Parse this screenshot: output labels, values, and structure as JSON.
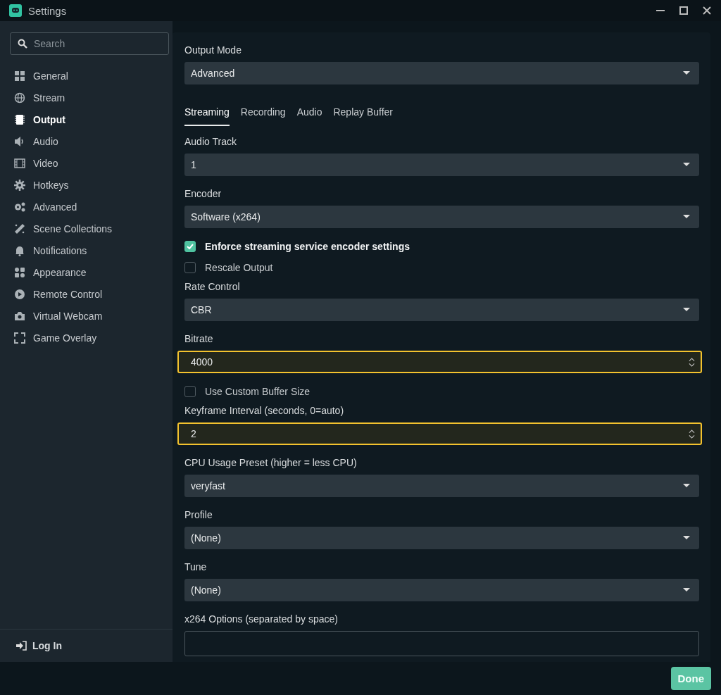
{
  "window": {
    "title": "Settings"
  },
  "sidebar": {
    "search": {
      "placeholder": "Search"
    },
    "items": [
      {
        "label": "General",
        "selected": false
      },
      {
        "label": "Stream",
        "selected": false
      },
      {
        "label": "Output",
        "selected": true
      },
      {
        "label": "Audio",
        "selected": false
      },
      {
        "label": "Video",
        "selected": false
      },
      {
        "label": "Hotkeys",
        "selected": false
      },
      {
        "label": "Advanced",
        "selected": false
      },
      {
        "label": "Scene Collections",
        "selected": false
      },
      {
        "label": "Notifications",
        "selected": false
      },
      {
        "label": "Appearance",
        "selected": false
      },
      {
        "label": "Remote Control",
        "selected": false
      },
      {
        "label": "Virtual Webcam",
        "selected": false
      },
      {
        "label": "Game Overlay",
        "selected": false
      }
    ],
    "login": "Log In"
  },
  "settings": [
    {
      "kind": "select",
      "label": "Output Mode",
      "value": "Advanced"
    },
    {
      "kind": "tabs",
      "tabs": [
        {
          "label": "Streaming",
          "selected": true
        },
        {
          "label": "Recording",
          "selected": false
        },
        {
          "label": "Audio",
          "selected": false
        },
        {
          "label": "Replay Buffer",
          "selected": false
        }
      ]
    },
    {
      "kind": "select",
      "label": "Audio Track",
      "value": "1"
    },
    {
      "kind": "select",
      "label": "Encoder",
      "value": "Software (x264)"
    },
    {
      "kind": "checkbox",
      "label": "Enforce streaming service encoder settings",
      "checked": true
    },
    {
      "kind": "checkbox",
      "label": "Rescale Output",
      "checked": false
    },
    {
      "kind": "select",
      "label": "Rate Control",
      "value": "CBR"
    },
    {
      "kind": "number",
      "label": "Bitrate",
      "value": "4000",
      "highlighted": true
    },
    {
      "kind": "checkbox",
      "label": "Use Custom Buffer Size",
      "checked": false
    },
    {
      "kind": "number",
      "label": "Keyframe Interval (seconds, 0=auto)",
      "value": "2",
      "highlighted": true
    },
    {
      "kind": "select",
      "label": "CPU Usage Preset (higher = less CPU)",
      "value": "veryfast"
    },
    {
      "kind": "select",
      "label": "Profile",
      "value": "(None)"
    },
    {
      "kind": "select",
      "label": "Tune",
      "value": "(None)"
    },
    {
      "kind": "text",
      "label": "x264 Options (separated by space)"
    }
  ],
  "footer": {
    "done": "Done"
  }
}
